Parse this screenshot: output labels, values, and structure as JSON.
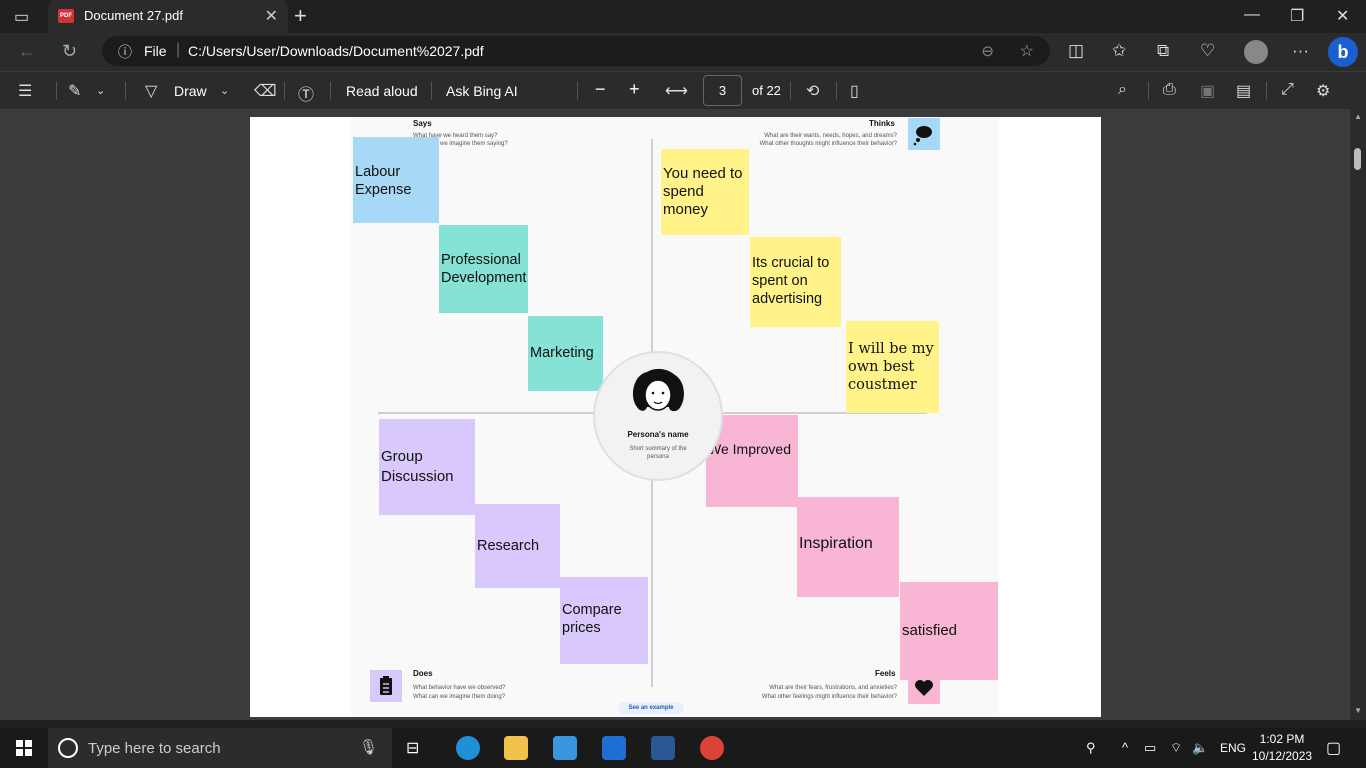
{
  "browser": {
    "tab_title": "Document 27.pdf",
    "tab_icon": "PDF",
    "new_tab_icon": "+",
    "file_label": "File",
    "url": "C:/Users/User/Downloads/Document%2027.pdf"
  },
  "pdf_toolbar": {
    "draw_label": "Draw",
    "read_aloud_label": "Read aloud",
    "ask_bing_label": "Ask Bing AI",
    "zoom_out": "−",
    "zoom_in": "+",
    "current_page": "3",
    "page_total": "of 22"
  },
  "empathy_map": {
    "says": {
      "title": "Says",
      "subtitle_1": "What have we heard them say?",
      "subtitle_2": "What can we imagine them saying?",
      "notes": [
        "Labour Expense",
        "Professional Development",
        "Marketing"
      ]
    },
    "thinks": {
      "title": "Thinks",
      "subtitle_1": "What are their wants, needs, hopes, and dreams?",
      "subtitle_2": "What other thoughts might influence their behavior?",
      "notes": [
        "You need to spend money",
        "Its crucial to spent on advertising",
        "I will be my own best coustmer"
      ]
    },
    "does": {
      "title": "Does",
      "subtitle_1": "What behavior have we observed?",
      "subtitle_2": "What can we imagine them doing?",
      "notes": [
        "Group Discussion",
        "Research",
        "Compare prices"
      ]
    },
    "feels": {
      "title": "Feels",
      "subtitle_1": "What are their fears, frustrations, and anxieties?",
      "subtitle_2": "What other feelings might influence their behavior?",
      "notes": [
        "We Improved",
        "Inspiration",
        "satisfied"
      ]
    },
    "persona_name": "Persona's name",
    "persona_summary": "Short summary of the persona",
    "see_example": "See an example"
  },
  "taskbar": {
    "search_placeholder": "Type here to search",
    "language": "ENG",
    "time": "1:02 PM",
    "date": "10/12/2023"
  },
  "colors": {
    "blue_note": "#a7d8f5",
    "teal_note": "#86e2d5",
    "yellow_note": "#fff38a",
    "pink_note": "#f8b6d4",
    "purple_note": "#d9c8fb",
    "bing_accent": "#1a5fd0"
  }
}
